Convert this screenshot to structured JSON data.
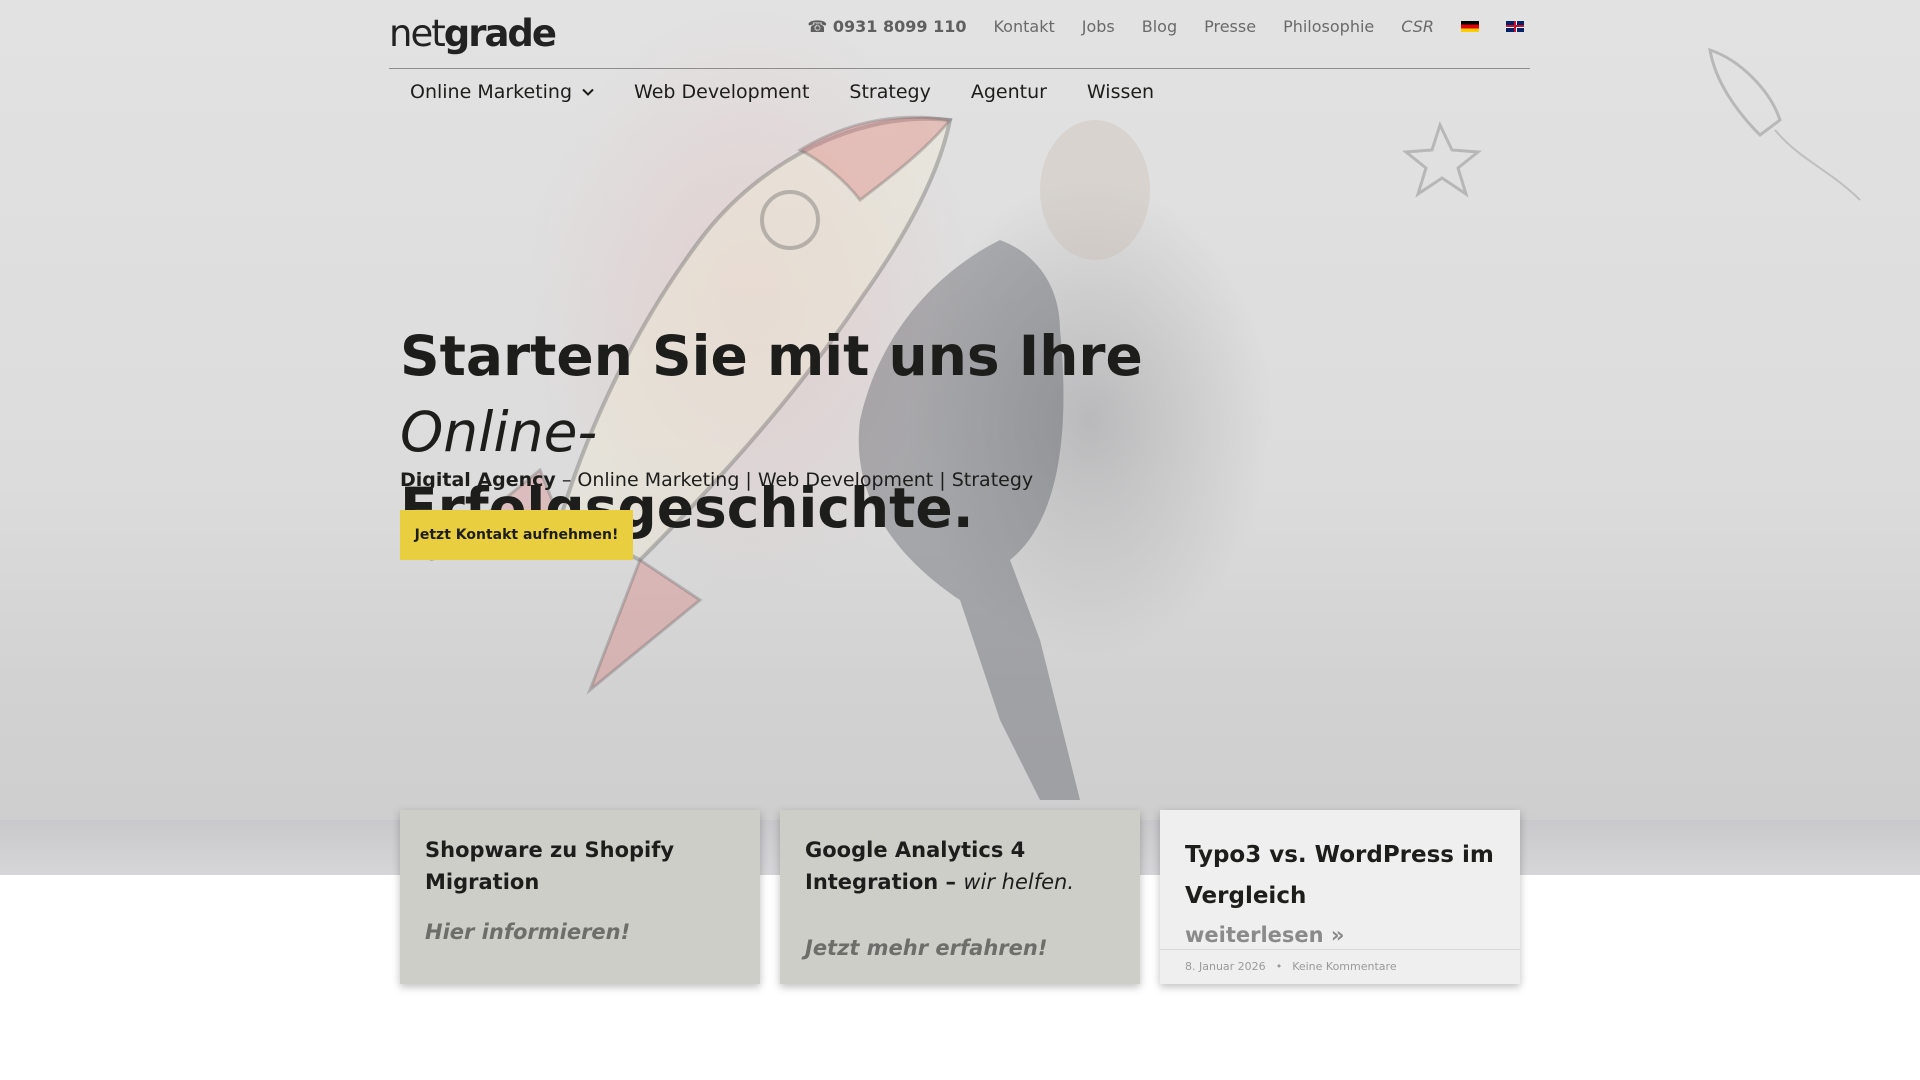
{
  "brand": {
    "logo_bold": "net",
    "logo_rest": "grade"
  },
  "topnav": {
    "phone": "☎ 0931 8099 110",
    "links": [
      "Kontakt",
      "Jobs",
      "Blog",
      "Presse",
      "Philosophie",
      "CSR"
    ],
    "flags": [
      "de-flag-icon",
      "en-flag-icon"
    ]
  },
  "mainnav": {
    "items": [
      "Online Marketing",
      "Web Development",
      "Strategy",
      "Agentur",
      "Wissen"
    ]
  },
  "hero": {
    "headline_part1": "Starten Sie mit uns Ihre ",
    "headline_italic": "Online-",
    "headline_part2": "Erfolgsgeschichte.",
    "sub_bold": "Digital Agency",
    "sub_rest": " – Online Marketing | Web Development | Strategy",
    "cta": "Jetzt Kontakt aufnehmen!"
  },
  "cards": [
    {
      "title": "Shopware zu Shopify Migration",
      "more": "Hier informieren!"
    },
    {
      "title": "Google Analytics 4 Integration – ",
      "title_italic": "wir helfen.",
      "more": "Jetzt mehr erfahren!"
    },
    {
      "title": "Typo3 vs. WordPress im Vergleich",
      "more": "weiterlesen »",
      "date": "8. Januar 2026",
      "separator": "•",
      "comments": "Keine Kommentare"
    }
  ],
  "colors": {
    "accent": "#e9cf3f",
    "text": "#1d1d1b",
    "card_bg": "#cecec9"
  }
}
